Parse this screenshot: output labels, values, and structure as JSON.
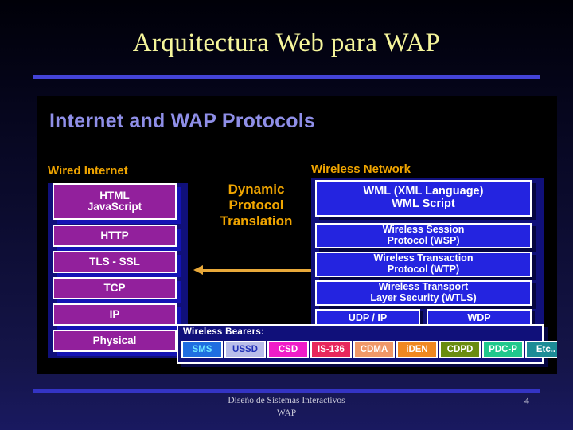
{
  "slide": {
    "title": "Arquitectura Web para WAP",
    "accent_rule_color": "#4343d8",
    "background_top": "#000008",
    "background_bottom": "#191960"
  },
  "diagram": {
    "heading": "Internet and WAP Protocols",
    "heading_color": "#8f8fe8",
    "panel_background": "#000000",
    "section_labels": {
      "wired": "Wired Internet",
      "wireless": "Wireless Network",
      "color": "#f0a500"
    },
    "translation": {
      "line1": "Dynamic",
      "line2": "Protocol",
      "line3": "Translation",
      "arrow_color": "#e8a93a",
      "arrow_direction": "double"
    },
    "wired_stack": {
      "box_color": "#92209c",
      "border_color": "#ffffff",
      "column_background": "#10107a",
      "boxes": [
        {
          "line1": "HTML",
          "line2": "JavaScript"
        },
        {
          "line1": "HTTP",
          "line2": ""
        },
        {
          "line1": "TLS - SSL",
          "line2": ""
        },
        {
          "line1": "TCP",
          "line2": ""
        },
        {
          "line1": "IP",
          "line2": ""
        },
        {
          "line1": "Physical",
          "line2": ""
        }
      ]
    },
    "wireless_stack": {
      "box_color": "#2424e0",
      "border_color": "#ffffff",
      "column_background": "#10107a",
      "boxes": [
        {
          "line1": "WML (XML Language)",
          "line2": "WML Script"
        },
        {
          "line1": "Wireless Session",
          "line2": "Protocol (WSP)"
        },
        {
          "line1": "Wireless Transaction",
          "line2": "Protocol (WTP)"
        },
        {
          "line1": "Wireless Transport",
          "line2": "Layer Security (WTLS)"
        }
      ],
      "half_boxes": [
        {
          "label": "UDP / IP"
        },
        {
          "label": "WDP"
        }
      ]
    },
    "bearers": {
      "title": "Wireless Bearers:",
      "panel_background": "#10107a",
      "chips": [
        {
          "label": "SMS",
          "bg": "#1f6ee0",
          "fg": "#6fe8ff"
        },
        {
          "label": "USSD",
          "bg": "#b8bcea",
          "fg": "#2030b8"
        },
        {
          "label": "CSD",
          "bg": "#f01cc8",
          "fg": "#ffffff"
        },
        {
          "label": "IS-136",
          "bg": "#e8285c",
          "fg": "#ffffff"
        },
        {
          "label": "CDMA",
          "bg": "#f09868",
          "fg": "#ffffff"
        },
        {
          "label": "iDEN",
          "bg": "#f08820",
          "fg": "#ffffff"
        },
        {
          "label": "CDPD",
          "bg": "#6a8c10",
          "fg": "#ffffff"
        },
        {
          "label": "PDC-P",
          "bg": "#20c88c",
          "fg": "#ffffff"
        },
        {
          "label": "Etc..",
          "bg": "#1c8c96",
          "fg": "#ffffff"
        }
      ]
    }
  },
  "footer": {
    "line1": "Diseño de Sistemas Interactivos",
    "line2": "WAP",
    "page_number": "4"
  }
}
